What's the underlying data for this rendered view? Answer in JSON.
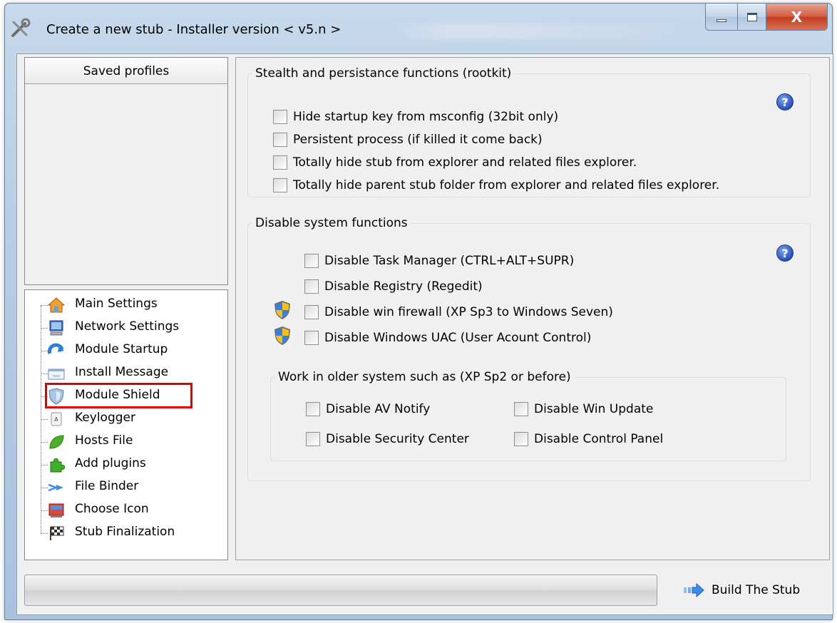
{
  "window": {
    "title": "Create a new stub - Installer version < v5.n >",
    "icon": "tools-icon",
    "controls": [
      "minimize",
      "maximize",
      "close"
    ],
    "close_glyph": "X"
  },
  "profiles": {
    "header": "Saved profiles"
  },
  "tree": {
    "items": [
      {
        "label": "Main Settings",
        "icon": "home-icon"
      },
      {
        "label": "Network Settings",
        "icon": "monitor-icon"
      },
      {
        "label": "Module Startup",
        "icon": "refresh-arrow-icon"
      },
      {
        "label": "Install Message",
        "icon": "message-box-icon"
      },
      {
        "label": "Module Shield",
        "icon": "shield-icon",
        "selected": true
      },
      {
        "label": "Keylogger",
        "icon": "key-icon"
      },
      {
        "label": "Hosts File",
        "icon": "leaf-icon"
      },
      {
        "label": "Add plugins",
        "icon": "puzzle-icon"
      },
      {
        "label": "File Binder",
        "icon": "merge-arrows-icon"
      },
      {
        "label": "Choose Icon",
        "icon": "picture-icon"
      },
      {
        "label": "Stub Finalization",
        "icon": "checkered-flag-icon"
      }
    ]
  },
  "stealth": {
    "legend": "Stealth and persistance functions  (rootkit)",
    "help": "?",
    "options": [
      "Hide startup key from msconfig (32bit only)",
      "Persistent process (if killed it come back)",
      "Totally hide stub from explorer and related files explorer.",
      "Totally hide parent stub folder from explorer and related files explorer."
    ]
  },
  "disable": {
    "legend": "Disable system functions",
    "help": "?",
    "options": [
      "Disable Task Manager (CTRL+ALT+SUPR)",
      "Disable Registry (Regedit)",
      "Disable win firewall (XP Sp3 to Windows Seven)",
      "Disable Windows UAC (User Acount Control)"
    ],
    "older": {
      "legend": "Work in older system such as (XP Sp2 or before)",
      "options": [
        "Disable AV Notify",
        "Disable Win Update",
        "Disable Security Center",
        "Disable Control Panel"
      ]
    }
  },
  "build_button": {
    "label": "Build The Stub",
    "icon": "blue-arrow-icon"
  },
  "colors": {
    "selection_box": "#e00000",
    "help_blue": "#2650b8"
  }
}
